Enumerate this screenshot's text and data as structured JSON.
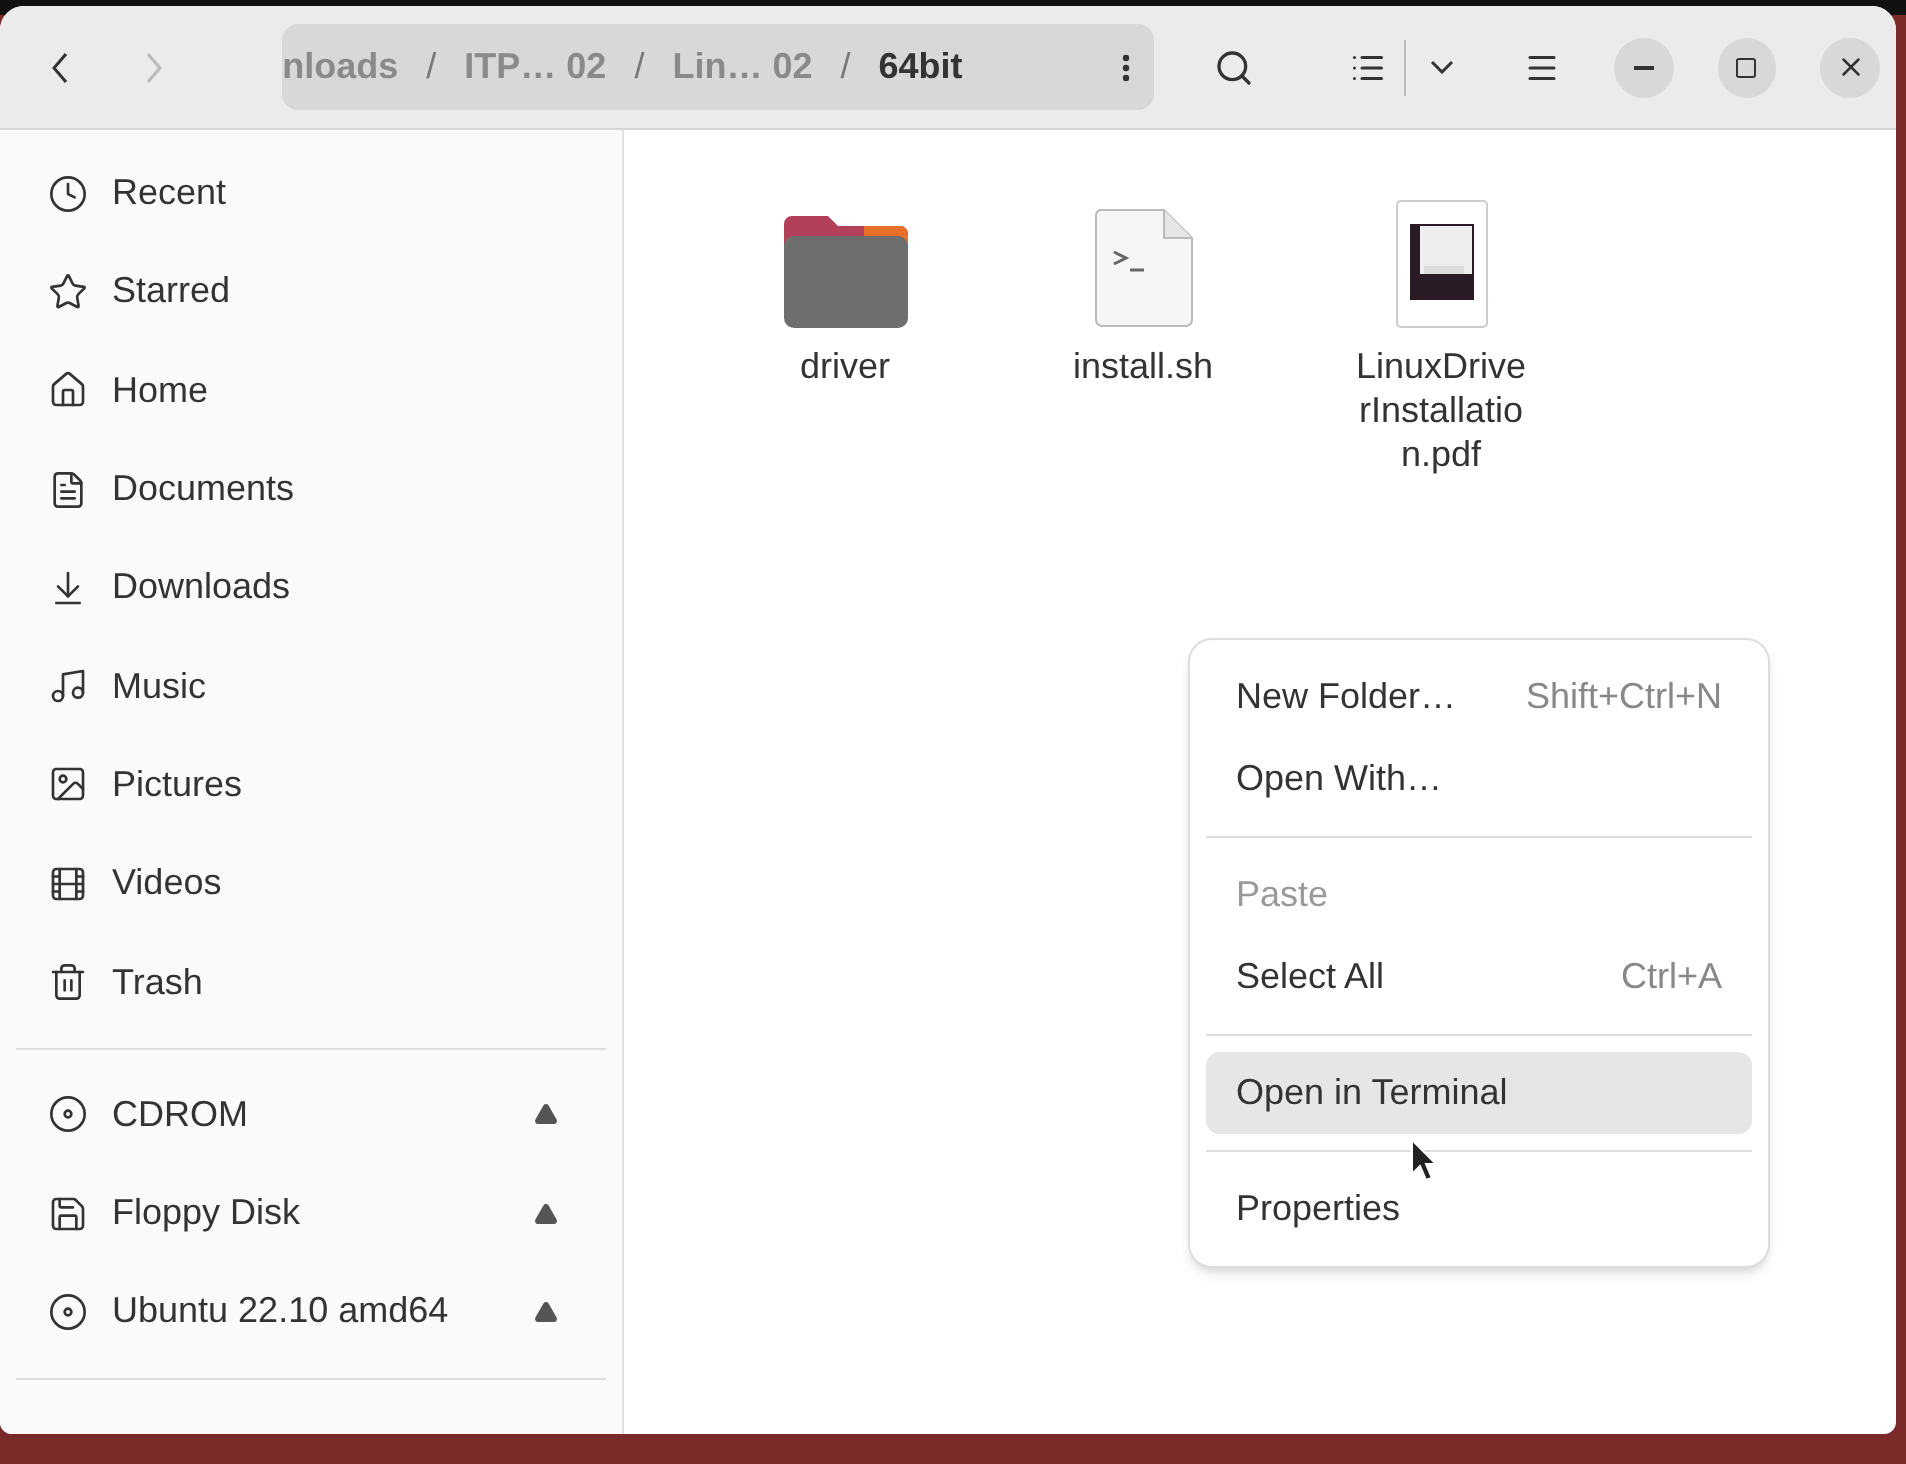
{
  "header": {
    "back": {
      "disabled": false
    },
    "forward": {
      "disabled": true
    },
    "breadcrumbs": [
      {
        "label": "nloads",
        "selected": false
      },
      {
        "separator": "/",
        "label": "ITP… 02",
        "selected": false
      },
      {
        "separator": "/",
        "label": "Lin… 02",
        "selected": false
      },
      {
        "separator": "/",
        "label": "64bit",
        "selected": true
      }
    ]
  },
  "sidebar": {
    "places": [
      {
        "label": "Recent",
        "kind": "recent"
      },
      {
        "label": "Starred",
        "kind": "starred"
      },
      {
        "label": "Home",
        "kind": "home"
      },
      {
        "label": "Documents",
        "kind": "documents"
      },
      {
        "label": "Downloads",
        "kind": "downloads"
      },
      {
        "label": "Music",
        "kind": "music"
      },
      {
        "label": "Pictures",
        "kind": "pictures"
      },
      {
        "label": "Videos",
        "kind": "videos"
      },
      {
        "label": "Trash",
        "kind": "trash"
      }
    ],
    "devices": [
      {
        "label": "CDROM",
        "kind": "disc"
      },
      {
        "label": "Floppy Disk",
        "kind": "floppy"
      },
      {
        "label": "Ubuntu 22.10 amd64",
        "kind": "disc"
      }
    ]
  },
  "files": [
    {
      "name": "driver",
      "kind": "folder"
    },
    {
      "name": "install.sh",
      "kind": "script"
    },
    {
      "name": "LinuxDriverInstallation.pdf",
      "kind": "pdf"
    }
  ],
  "context_menu": [
    {
      "kind": "item",
      "label": "New Folder…",
      "shortcut": "Shift+Ctrl+N",
      "disabled": false,
      "selected": false
    },
    {
      "kind": "item",
      "label": "Open With…",
      "disabled": false,
      "selected": false
    },
    {
      "kind": "separator"
    },
    {
      "kind": "item",
      "label": "Paste",
      "disabled": true,
      "selected": false
    },
    {
      "kind": "item",
      "label": "Select All",
      "shortcut": "Ctrl+A",
      "disabled": false,
      "selected": false
    },
    {
      "kind": "separator"
    },
    {
      "kind": "item",
      "label": "Open in Terminal",
      "disabled": false,
      "selected": true
    },
    {
      "kind": "separator"
    },
    {
      "kind": "item",
      "label": "Properties",
      "disabled": false,
      "selected": false
    }
  ]
}
